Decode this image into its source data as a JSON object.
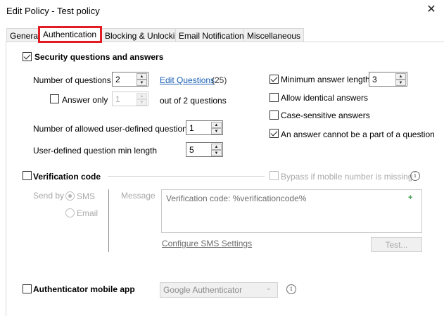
{
  "window": {
    "title": "Edit Policy - Test policy",
    "close_glyph": "✕"
  },
  "tabs": [
    {
      "label": "General"
    },
    {
      "label": "Authentication"
    },
    {
      "label": "Blocking & Unlocking"
    },
    {
      "label": "Email Notifications"
    },
    {
      "label": "Miscellaneous"
    }
  ],
  "security": {
    "enabled": true,
    "title": "Security questions and answers",
    "num_questions_label": "Number of questions",
    "num_questions_value": "2",
    "edit_questions_link": "Edit Questions",
    "edit_questions_count": "(25)",
    "answer_only_label": "Answer only",
    "answer_only_value": "1",
    "out_of_label": "out of 2 questions",
    "allowed_user_defined_label": "Number of allowed user-defined questions",
    "allowed_user_defined_value": "1",
    "user_defined_min_length_label": "User-defined question min length",
    "user_defined_min_length_value": "5",
    "min_answer_length_label": "Minimum answer length",
    "min_answer_length_value": "3",
    "allow_identical_label": "Allow identical answers",
    "case_sensitive_label": "Case-sensitive answers",
    "answer_not_part_label": "An answer cannot be a part of a question"
  },
  "verification": {
    "title": "Verification code",
    "bypass_label": "Bypass if mobile number is missing",
    "send_by_label": "Send by",
    "sms_label": "SMS",
    "email_label": "Email",
    "message_label": "Message",
    "message_value": "Verification code: %verificationcode%",
    "configure_link": "Configure SMS Settings",
    "test_button": "Test..."
  },
  "authenticator": {
    "title": "Authenticator mobile app",
    "selected": "Google Authenticator"
  },
  "icons": {
    "info": "i",
    "chevron": "⌄",
    "insert": "+"
  }
}
